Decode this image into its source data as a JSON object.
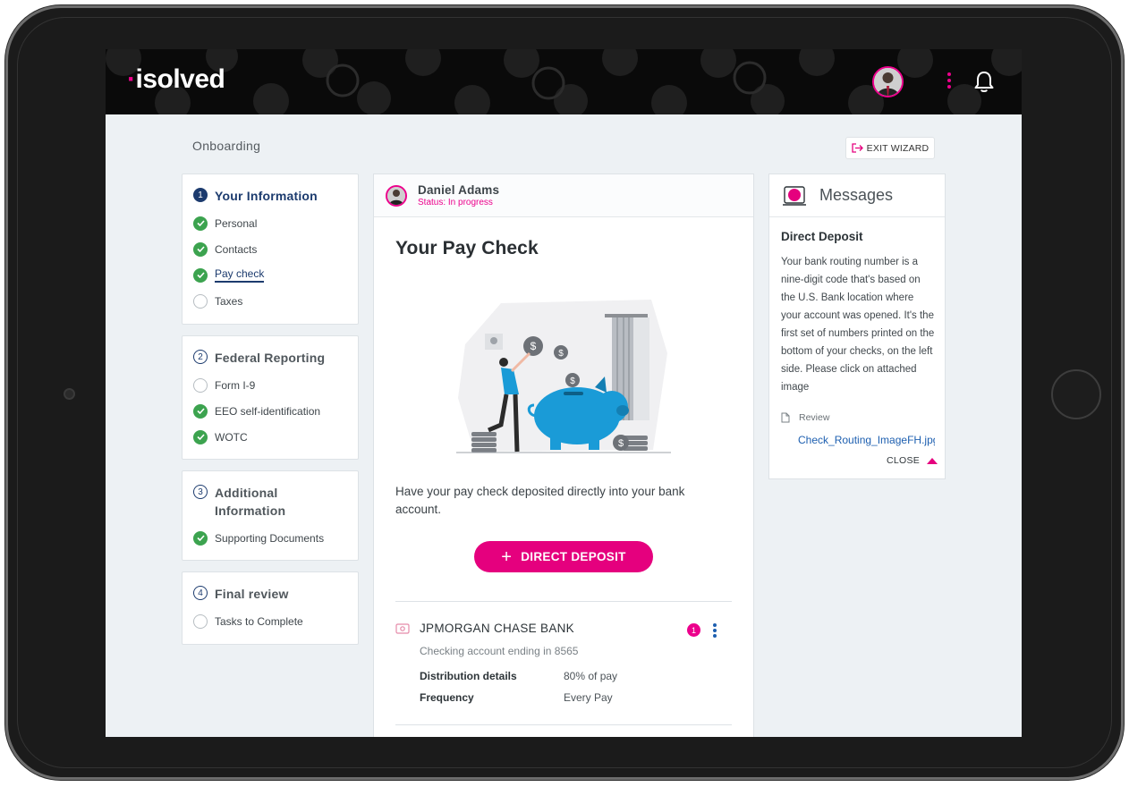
{
  "app": {
    "logo_text": "isolved",
    "logo_color": "#ec008c"
  },
  "header": {
    "avatar": "user-avatar",
    "menu_icon": "kebab-menu-icon",
    "notifications_icon": "bell-icon"
  },
  "page": {
    "breadcrumb": "Onboarding",
    "exit_label": "EXIT WIZARD"
  },
  "steps": [
    {
      "num": "1",
      "title": "Your Information",
      "active": true,
      "items": [
        {
          "label": "Personal",
          "state": "done"
        },
        {
          "label": "Contacts",
          "state": "done"
        },
        {
          "label": "Pay check",
          "state": "current"
        },
        {
          "label": "Taxes",
          "state": "todo"
        }
      ]
    },
    {
      "num": "2",
      "title": "Federal Reporting",
      "active": false,
      "items": [
        {
          "label": "Form I-9",
          "state": "todo"
        },
        {
          "label": "EEO self-identification",
          "state": "done"
        },
        {
          "label": "WOTC",
          "state": "done"
        }
      ]
    },
    {
      "num": "3",
      "title_line1": "Additional",
      "title_line2": "Information",
      "active": false,
      "items": [
        {
          "label": "Supporting Documents",
          "state": "done"
        }
      ]
    },
    {
      "num": "4",
      "title": "Final review",
      "active": false,
      "items": [
        {
          "label": "Tasks to Complete",
          "state": "todo"
        }
      ]
    }
  ],
  "employee": {
    "name": "Daniel Adams",
    "status": "Status: In progress"
  },
  "main": {
    "heading": "Your Pay Check",
    "description": "Have your pay check deposited directly into your bank account.",
    "direct_deposit_label": "DIRECT DEPOSIT",
    "bank": {
      "name": "JPMORGAN CHASE BANK",
      "account": "Checking account ending in 8565",
      "badge": "1",
      "distribution_label": "Distribution details",
      "distribution_value": "80% of pay",
      "frequency_label": "Frequency",
      "frequency_value": "Every Pay"
    }
  },
  "messages": {
    "title": "Messages",
    "subject": "Direct Deposit",
    "body": "Your bank routing number is a nine-digit code that's based on the U.S. Bank location where your account was opened. It's the first set of numbers printed on the bottom of your checks, on the left side. Please click on attached image",
    "review_label": "Review",
    "attachment": "Check_Routing_ImageFH.jpg",
    "close_label": "CLOSE"
  },
  "colors": {
    "accent": "#ec008c",
    "primary": "#1c3b6e",
    "success": "#3ca34f",
    "link": "#1d5fb0"
  }
}
